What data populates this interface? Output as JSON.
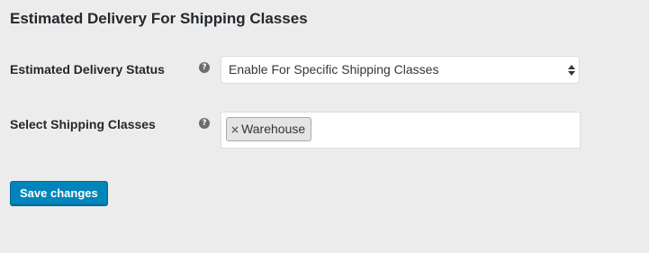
{
  "section": {
    "title": "Estimated Delivery For Shipping Classes"
  },
  "fields": {
    "status": {
      "label": "Estimated Delivery Status",
      "value": "Enable For Specific Shipping Classes",
      "help_icon": "question-circle-icon"
    },
    "classes": {
      "label": "Select Shipping Classes",
      "selected": [
        "Warehouse"
      ],
      "remove_glyph": "×",
      "help_icon": "question-circle-icon"
    }
  },
  "actions": {
    "save_label": "Save changes"
  },
  "colors": {
    "background": "#ececec",
    "primary_button": "#0085ba",
    "token_background": "#e4e4e4"
  }
}
